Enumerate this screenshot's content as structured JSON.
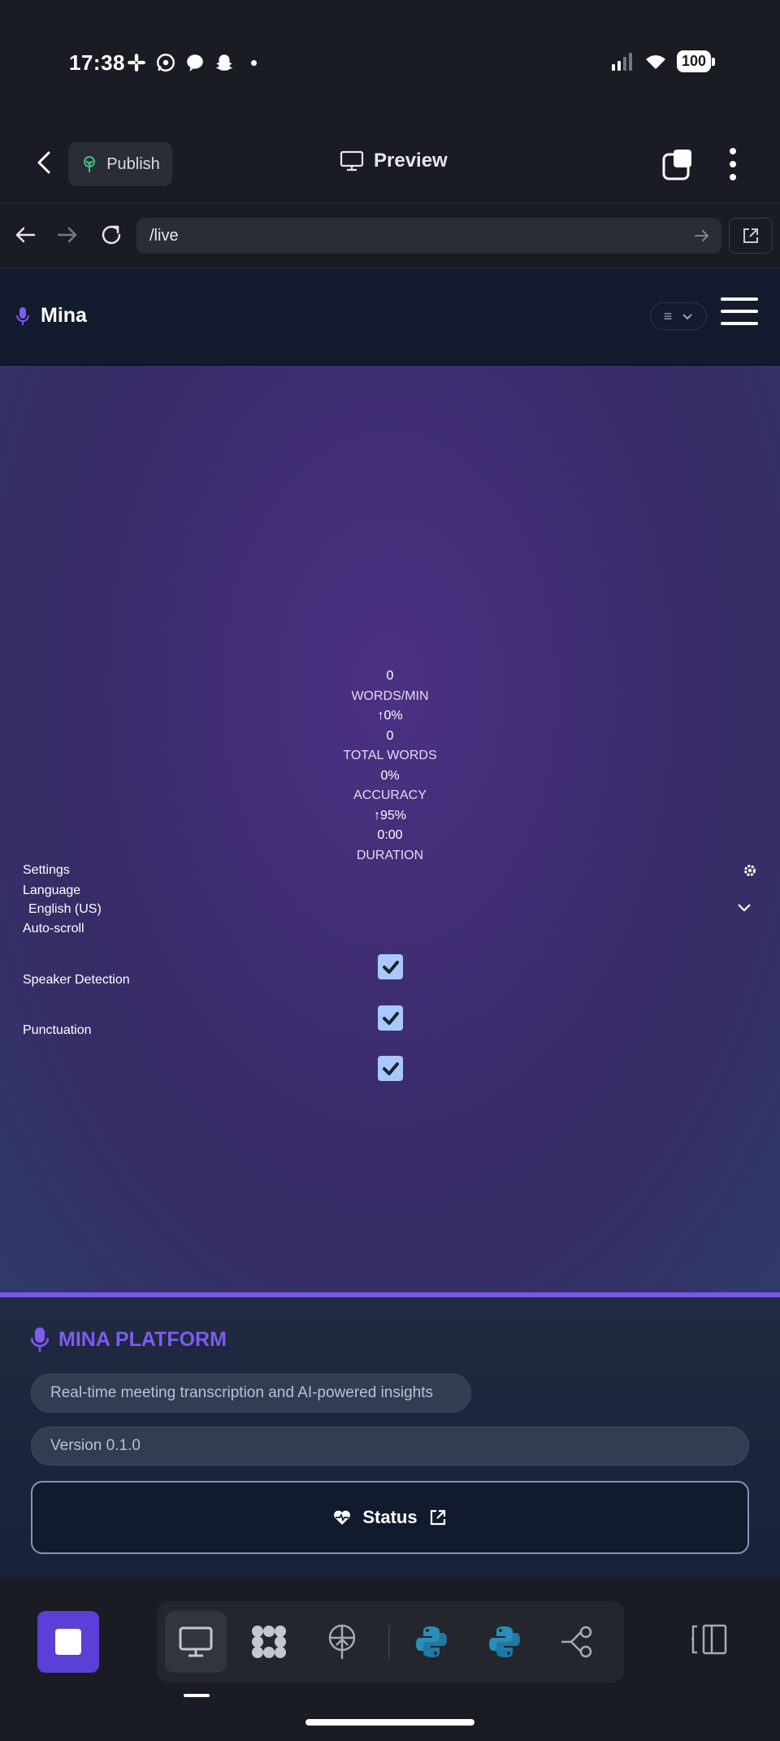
{
  "status_bar": {
    "time": "17:38",
    "battery": "100",
    "notification_icons": [
      "slack-icon",
      "whatsapp-icon",
      "messenger-icon",
      "snapchat-icon"
    ]
  },
  "top_bar": {
    "publish_label": "Publish",
    "preview_label": "Preview"
  },
  "url_bar": {
    "url": "/live"
  },
  "app_header": {
    "brand_name": "Mina",
    "view_select_glyph": "≡"
  },
  "stats": [
    {
      "value": "0",
      "label": "WORDS/MIN",
      "change": "0%",
      "change_arrow": true
    },
    {
      "value": "0",
      "label": "TOTAL WORDS",
      "change": "0%",
      "change_arrow": false
    },
    {
      "value": "",
      "label": "ACCURACY",
      "change": "95%",
      "change_arrow": true
    },
    {
      "value": "0:00",
      "label": "DURATION"
    }
  ],
  "settings": {
    "title": "Settings",
    "language_label": "Language",
    "language_value": "English (US)",
    "auto_scroll_label": "Auto-scroll",
    "auto_scroll_checked": true,
    "speaker_detection_label": "Speaker Detection",
    "speaker_detection_checked": true,
    "punctuation_label": "Punctuation",
    "punctuation_checked": true
  },
  "footer": {
    "brand": "MINA PLATFORM",
    "tagline": "Real-time meeting transcription and AI-powered insights",
    "version": "Version 0.1.0",
    "status_label": "Status"
  },
  "colors": {
    "accent": "#7b57e8",
    "footer_brand": "#7d5cf0",
    "stop_button": "#5b3fd6",
    "checkbox": "#a9c8fb"
  },
  "dock": {
    "items": [
      "desktop-icon",
      "agents-icon",
      "deploy-icon",
      "python-icon",
      "python-icon",
      "git-icon"
    ]
  }
}
